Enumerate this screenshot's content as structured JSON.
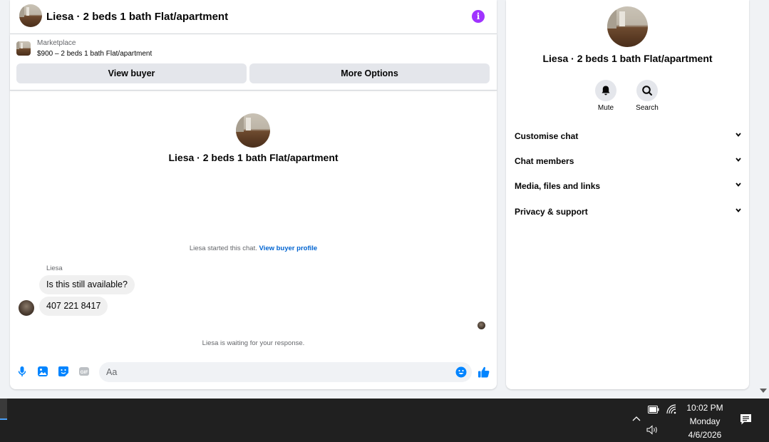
{
  "chat": {
    "header_title": "Liesa · 2 beds 1 bath Flat/apartment",
    "info_icon": "info-icon",
    "listing": {
      "source": "Marketplace",
      "description": "$900 – 2 beds 1 bath Flat/apartment"
    },
    "buttons": {
      "view_buyer": "View buyer",
      "more_options": "More Options"
    },
    "center_title": "Liesa · 2 beds 1 bath Flat/apartment",
    "started_note": "Liesa started this chat.",
    "view_buyer_profile": "View buyer profile",
    "sender_name": "Liesa",
    "messages": [
      {
        "text": "Is this still available?"
      },
      {
        "text": "407 221 8417"
      }
    ],
    "waiting_note": "Liesa is waiting for your response.",
    "composer": {
      "placeholder": "Aa",
      "icons": [
        "mic-icon",
        "photo-icon",
        "sticker-icon",
        "gif-icon",
        "emoji-icon",
        "like-icon"
      ]
    }
  },
  "info_panel": {
    "title": "Liesa · 2 beds 1 bath Flat/apartment",
    "actions": [
      {
        "label": "Mute",
        "icon": "bell-icon"
      },
      {
        "label": "Search",
        "icon": "search-icon"
      }
    ],
    "sections": [
      {
        "label": "Customise chat"
      },
      {
        "label": "Chat members"
      },
      {
        "label": "Media, files and links"
      },
      {
        "label": "Privacy & support"
      }
    ]
  },
  "taskbar": {
    "time": "10:02 PM",
    "day": "Monday",
    "date": "4/6/2026"
  },
  "colors": {
    "accent_blue": "#0084ff",
    "link_blue": "#0064d1",
    "info_purple": "#a033ff",
    "button_gray": "#e4e6eb",
    "taskbar": "#202020"
  }
}
